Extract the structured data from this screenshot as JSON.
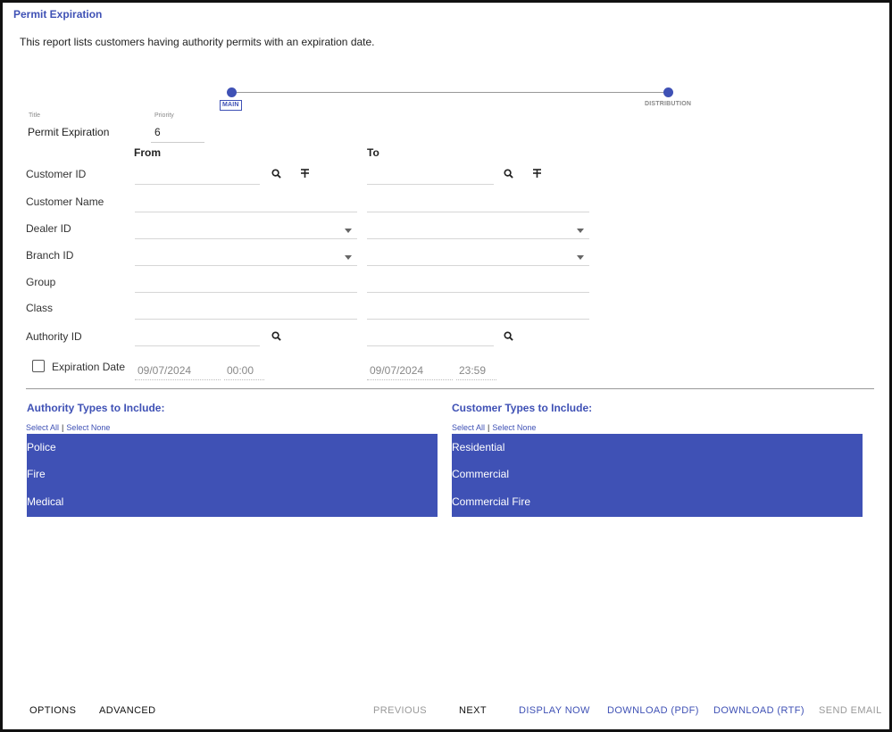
{
  "header": {
    "title": "Permit Expiration",
    "description": "This report lists customers having authority permits with an expiration date."
  },
  "stepper": {
    "steps": [
      {
        "label": "MAIN",
        "active": true
      },
      {
        "label": "DISTRIBUTION",
        "active": false
      }
    ]
  },
  "meta": {
    "title_label": "Title",
    "title_value": "Permit Expiration",
    "priority_label": "Priority",
    "priority_value": "6"
  },
  "columns": {
    "from": "From",
    "to": "To"
  },
  "rows": {
    "customer_id": "Customer ID",
    "customer_name": "Customer Name",
    "dealer_id": "Dealer ID",
    "branch_id": "Branch ID",
    "group": "Group",
    "class": "Class",
    "authority_id": "Authority ID",
    "expiration_date": "Expiration Date"
  },
  "dates": {
    "from_date": "09/07/2024",
    "from_time": "00:00",
    "to_date": "09/07/2024",
    "to_time": "23:59"
  },
  "authority_types": {
    "title": "Authority Types to Include:",
    "select_all": "Select All",
    "select_none": "Select None",
    "items": [
      "Police",
      "Fire",
      "Medical"
    ]
  },
  "customer_types": {
    "title": "Customer Types to Include:",
    "select_all": "Select All",
    "select_none": "Select None",
    "items": [
      "Residential",
      "Commercial",
      "Commercial Fire"
    ]
  },
  "footer": {
    "options": "OPTIONS",
    "advanced": "ADVANCED",
    "previous": "PREVIOUS",
    "next": "NEXT",
    "display_now": "DISPLAY NOW",
    "download_pdf": "DOWNLOAD (PDF)",
    "download_rtf": "DOWNLOAD (RTF)",
    "send_email": "SEND EMAIL"
  },
  "colors": {
    "accent": "#3f51b5",
    "frame": "#111111"
  },
  "icons": [
    "search-icon",
    "range-filter-icon",
    "chevron-down-icon",
    "checkbox-icon"
  ]
}
